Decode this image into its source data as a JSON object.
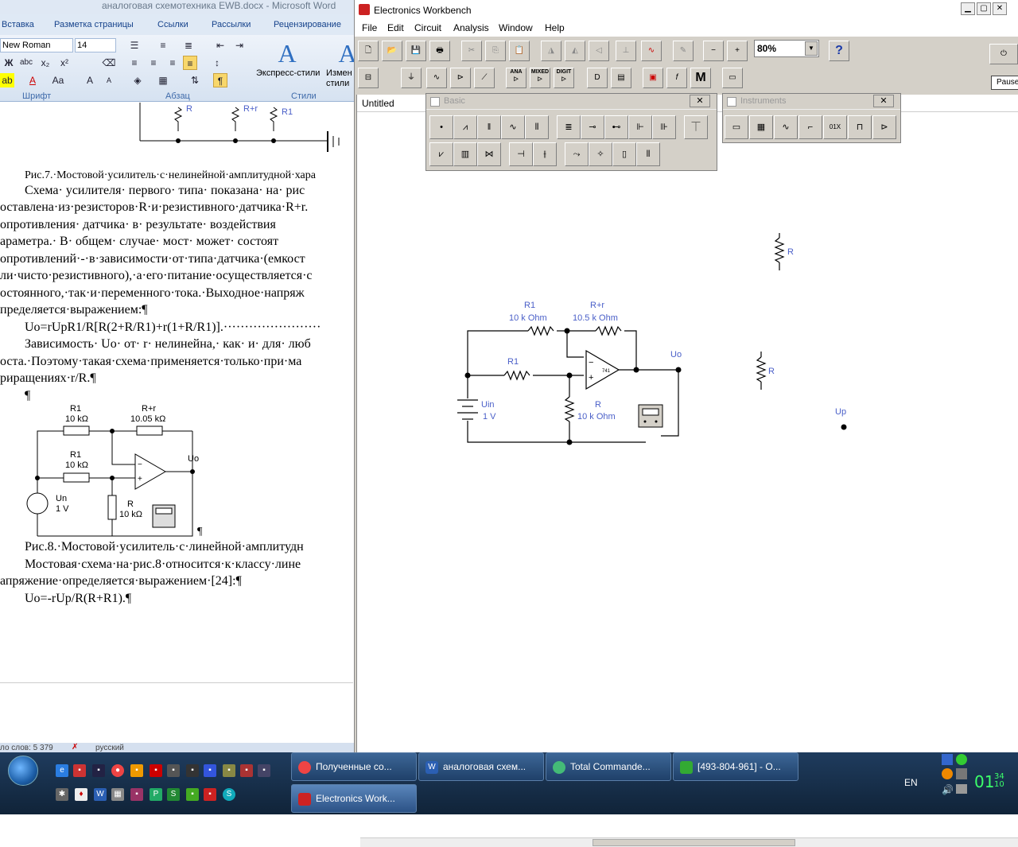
{
  "word": {
    "title": "аналоговая схемотехника EWB.docx  -  Microsoft Word",
    "tabs": [
      "Вставка",
      "Разметка страницы",
      "Ссылки",
      "Рассылки",
      "Рецензирование"
    ],
    "font_name": "New Roman",
    "font_size": "14",
    "group_font": "Шрифт",
    "group_para": "Абзац",
    "group_styles": "Стили",
    "express_styles": "Экспресс-стили",
    "change_styles": "Измен стили",
    "status_words": "ло слов: 5 379",
    "status_lang": "русский",
    "doc": {
      "fig7_caption": "Рис.7.·Мостовой·усилитель·с·нелинейной·амплитудной·хара",
      "p1": "Схема· усилителя· первого· типа· показана· на· рис",
      "p2": "оставлена·из·резисторов·R·и·резистивного·датчика·R+r.",
      "p3": "опротивления· датчика· в· результате· воздействия",
      "p4": "араметра.· В· общем· случае· мост· может· состоят",
      "p5": "опротивлений·-·в·зависимости·от·типа·датчика·(емкост",
      "p6": "ли·чисто·резистивного),·а·его·питание·осуществляется·с",
      "p7": "остоянного,·так·и·переменного·тока.·Выходное·напряж",
      "p8": "пределяется·выражением:¶",
      "formula1": "Uo=rUpR1/R[R(2+R/R1)+r(1+R/R1)].·······················",
      "p9": "Зависимость· Uo· от· r· нелинейна,· как· и· для· люб",
      "p10": "оста.·Поэтому·такая·схема·применяется·только·при·ма",
      "p11": "риращениях·r/R.¶",
      "pilcrow": "¶",
      "fig8_caption": "Рис.8.·Мостовой·усилитель·с·линейной·амплитудн",
      "p12": "Мостовая·схема·на·рис.8·относится·к·классу·лине",
      "p13": "апряжение·определяется·выражением·[24]:¶",
      "formula2": "Uo=-rUp/R(R+R1).¶",
      "fig_top": {
        "r_label": "R",
        "rr_label": "R+r",
        "r1_label": "R1"
      },
      "fig8": {
        "r1_top": "R1",
        "r1_top_val": "10 kΩ",
        "rr": "R+r",
        "rr_val": "10.05 kΩ",
        "r1_mid": "R1",
        "r1_mid_val": "10 kΩ",
        "uo": "Uo",
        "un": "Un",
        "un_val": "1 V",
        "r": "R",
        "r_val": "10 kΩ",
        "pilcrow": "¶"
      }
    }
  },
  "ewb": {
    "title": "Electronics Workbench",
    "menu": [
      "File",
      "Edit",
      "Circuit",
      "Analysis",
      "Window",
      "Help"
    ],
    "zoom": "80%",
    "pause": "Pause",
    "toolbar2_labels": [
      "ANA",
      "MIXED",
      "DIGIT",
      "M"
    ],
    "circuit_title": "Untitled",
    "basic_palette": "Basic",
    "instruments_palette": "Instruments",
    "circuit": {
      "r1_top": "R1",
      "r1_top_val": "10 k Ohm",
      "rr": "R+r",
      "rr_val": "10.5 k Ohm",
      "r1_mid": "R1",
      "uo": "Uo",
      "uin": "Uin",
      "uin_val": "1 V",
      "r": "R",
      "r_val": "10 k Ohm",
      "r_free1": "R",
      "r_free2": "R",
      "up": "Up"
    }
  },
  "taskbar": {
    "tasks": [
      "Полученные со...",
      "аналоговая схем...",
      "Total Commande...",
      "[493-804-961] - О...",
      "Electronics Work..."
    ],
    "lang": "EN",
    "clock_hm": "01",
    "clock_s1": "34",
    "clock_s2": "10"
  },
  "colors": {
    "ewb_label": "#4a5fc8",
    "taskbar": "#1f3c5e",
    "clock": "#3cff6a"
  }
}
